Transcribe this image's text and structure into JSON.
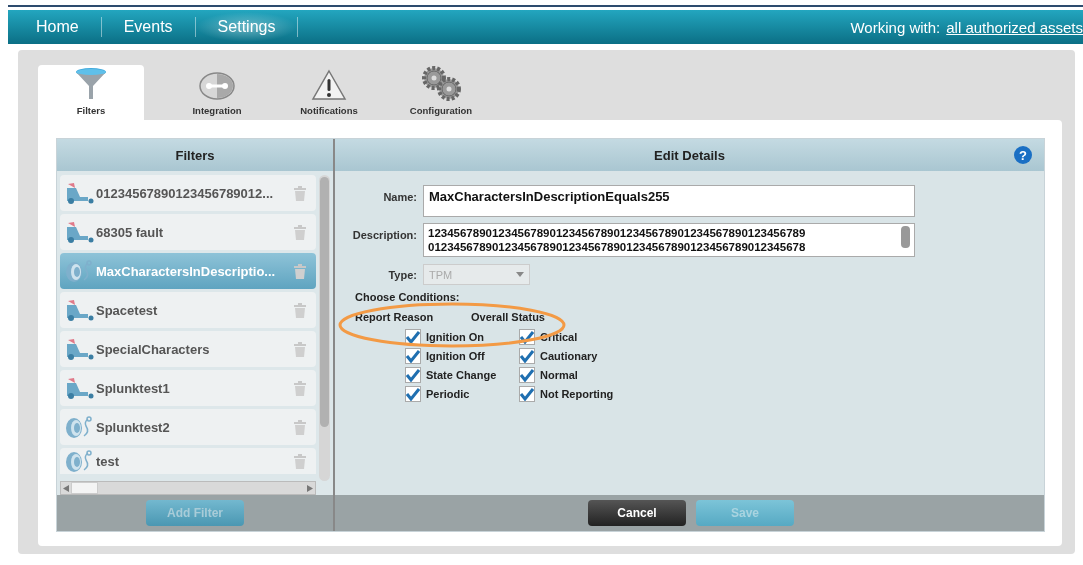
{
  "nav": {
    "items": [
      {
        "label": "Home",
        "selected": false
      },
      {
        "label": "Events",
        "selected": false
      },
      {
        "label": "Settings",
        "selected": true
      }
    ],
    "working_with_label": "Working with:",
    "working_with_link": "all authorized assets"
  },
  "tabs": [
    {
      "label": "Filters",
      "kind": "funnel",
      "selected": true
    },
    {
      "label": "Integration",
      "kind": "integration",
      "selected": false
    },
    {
      "label": "Notifications",
      "kind": "warning",
      "selected": false
    },
    {
      "label": "Configuration",
      "kind": "gears",
      "selected": false
    }
  ],
  "filters": {
    "title": "Filters",
    "items": [
      {
        "name": "01234567890123456789012...",
        "kind": "vehicle",
        "selected": false
      },
      {
        "name": "68305 fault",
        "kind": "vehicle",
        "selected": false
      },
      {
        "name": "MaxCharactersInDescriptio...",
        "kind": "tire",
        "selected": true
      },
      {
        "name": "Spacetest",
        "kind": "vehicle",
        "selected": false
      },
      {
        "name": "SpecialCharacters",
        "kind": "vehicle",
        "selected": false
      },
      {
        "name": "Splunktest1",
        "kind": "vehicle",
        "selected": false
      },
      {
        "name": "Splunktest2",
        "kind": "tire",
        "selected": false
      },
      {
        "name": "test",
        "kind": "tire",
        "selected": false
      }
    ],
    "add_button": {
      "label": "Add Filter",
      "disabled": true
    }
  },
  "details": {
    "title": "Edit Details",
    "help": "?",
    "name_label": "Name:",
    "name_value": "MaxCharactersInDescriptionEquals255",
    "description_label": "Description:",
    "description_value": "12345678901234567890123456789012345678901234567890123456789\n01234567890123456789012345678901234567890123456789012345678",
    "type_label": "Type:",
    "type_value": "TPM",
    "type_disabled": true,
    "conditions_label": "Choose Conditions:",
    "groups": [
      {
        "title": "Report Reason",
        "options": [
          {
            "label": "Ignition On",
            "checked": true
          },
          {
            "label": "Ignition Off",
            "checked": true
          },
          {
            "label": "State Change",
            "checked": true
          },
          {
            "label": "Periodic",
            "checked": true
          }
        ]
      },
      {
        "title": "Overall Status",
        "options": [
          {
            "label": "Critical",
            "checked": true
          },
          {
            "label": "Cautionary",
            "checked": true
          },
          {
            "label": "Normal",
            "checked": true
          },
          {
            "label": "Not Reporting",
            "checked": true
          }
        ]
      }
    ],
    "cancel_button": {
      "label": "Cancel",
      "disabled": false
    },
    "save_button": {
      "label": "Save",
      "disabled": true
    }
  }
}
